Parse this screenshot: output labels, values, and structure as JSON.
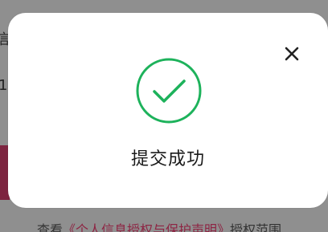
{
  "background": {
    "text_1": "信",
    "text_2": "1",
    "footer_prefix": "查看",
    "footer_link": "《个人信息授权与保护声明》",
    "footer_suffix": "授权范围"
  },
  "dialog": {
    "message": "提交成功",
    "icon": "check-circle-icon",
    "close_icon": "close-icon",
    "accent_color": "#1db25b"
  }
}
